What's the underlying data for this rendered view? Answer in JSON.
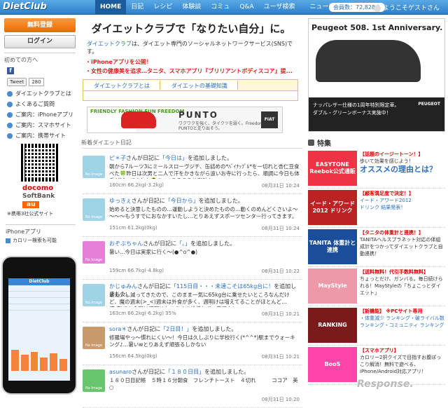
{
  "header": {
    "logo": "DietClub",
    "nav": [
      "HOME",
      "日記",
      "レシピ",
      "体験談",
      "コミュ",
      "Q&A",
      "ユーザ検索",
      "ニュース"
    ],
    "new_badge": "new",
    "members": "会員数：72,828人",
    "guest": "ようこそゲストさん"
  },
  "left": {
    "register": "無料登録",
    "login": "ログイン",
    "first_time": "初めての方へ",
    "tweet": "Tweet",
    "tweet_count": "280",
    "links": [
      "ダイエットクラブとは",
      "よくあるご質問",
      "ご案内：iPhoneアプリ",
      "ご案内：スマホサイト",
      "ご案内：携帯サイト"
    ],
    "docomo": "docomo",
    "softbank": "SoftBank",
    "au": "au",
    "mobile_note": "※携帯3社公式サイト",
    "iphone_app": "iPhoneアプリ",
    "calorie": "カロリー検索も可能"
  },
  "main": {
    "headline": "ダイエットクラブで「なりたい自分」に。",
    "intro_link": "ダイエットクラブ",
    "intro_rest": "は、ダイエット専門のソーシャルネットワークサービス(SNS)です。",
    "red1": "・iPhoneアプリを公開！",
    "red2": "・女性の健康美を追求…タニタ、スマホアプリ『ブリリアントボディスコア』提...",
    "tab1": "ダイエットクラブとは",
    "tab2": "ダイエットの基礎知識",
    "ad": {
      "left": "FRIENDLY FASHION FUN FREEDOM",
      "title": "PUNTO",
      "sub": "ワクワクを強く、タイクツを弱く。Freedom＝PUNTOと走り出そう。",
      "fiat": "FIAT"
    },
    "feed_head": "新着ダイエット日記",
    "entries": [
      {
        "user": "ピ＊子",
        "mid": "さんが日記に",
        "title": "「今日は」",
        "end": "を追加しました。",
        "body": "朝から7ルーツ3にミールスローヴジチ、缶詰めの*ﾊﾞｲﾅｯﾌﾟﾙ*を一切れと杏仁豆食べた🍀昨日は次男と二人で汗をかきながら遠いお寺に行ったら、順調に今日も体重が減ってました🙆あっ♪そろそろ体脂肪も…",
        "meta": "160cm 66.2kg(-3.2kg)",
        "date": "08月31日 10:24"
      },
      {
        "user": "ゆっきぇ",
        "mid": "さんが日記に",
        "title": "「今日から」",
        "end": "を追加しました。",
        "body": "始めると決意したものの…運動しようと決めたものの…動くのめんどくさいよ～～～～もうすでにおなかすいたし…とりあえずスポーツセンター行ってきます。",
        "meta": "151cm 61.2kg(0kg)",
        "date": "08月31日 10:24"
      },
      {
        "user": "おぞぶちゃん",
        "mid": "さんが日記に",
        "title": "「。」",
        "end": "を追加しました。",
        "body": "暑い…今日は実家に行く～(●^o^●)",
        "meta": "159cm 66.7kg(-4.8kg)",
        "date": "08月31日 10:22"
      },
      {
        "user": "かじゅみん",
        "mid": "さんが日記に",
        "title": "「115日目・・・未達こそは65kg台に！",
        "end": "を追加しました。",
        "body": "最近少し減ってきたので、このまま一気に65kg台に乗せたいところなんだけど、魔の週末(>_<)週末は外食が多く、週明けは増えてることがほとんど…(T_T)でも今回は週明けもこのまま維持して、来週中に…",
        "meta": "163cm 66.2kg(-6.2kg) 35%",
        "date": "08月31日 10:21"
      },
      {
        "user": "sora＊",
        "mid": "さんが日記に",
        "title": "「2日目！」",
        "end": "を追加しました。",
        "body": "修羅場やっ～慣れにくい～！今日は久しぶりに学校行く(*^^*)駅までウォーキング♪…暑いwとりあえず頑張るしかない",
        "meta": "156cm 64.5kg(0kg)",
        "date": "08月31日 10:21"
      },
      {
        "user": "asunaro",
        "mid": "さんが日記に",
        "title": "「１８０日目」",
        "end": "を追加しました。",
        "body": "１８０日目記帳　５時１６分朝食　フレンチトースト　４切れ　　　ココア　美　○",
        "meta": "",
        "date": "08月31日 10:20"
      }
    ]
  },
  "right": {
    "peugeot_title": "Peugeot 508. 1st Anniversary.",
    "peugeot_copy1": "ナッパレザー仕様の1周年特別限定車。",
    "peugeot_copy2": "ダブル・グリーンボーナス実施中！",
    "peugeot_logo": "PEUGEOT",
    "tokushu": "特集",
    "features": [
      {
        "logo": "EASYTONE Reebok公式通販",
        "h": "【話題のイージートーン！】",
        "l1": "歩いて効果を感じよう！",
        "big": "オススメの理由とは？",
        "c": "#e34"
      },
      {
        "logo": "イード・アワード2012 ドリンク",
        "h": "【顧客満足度で決定！】",
        "l1": "イード・アワード2012",
        "big": "ドリンク 結果発表！",
        "c": "#b22"
      },
      {
        "logo": "TANITA 体重計と連携",
        "h": "【タニタの体重計と連携！】",
        "l1": "TANITAヘルスプラネット対応の体組成計をつかってダイエットクラブと自動連携！",
        "big": "",
        "c": "#1a4e9a"
      },
      {
        "logo": "MayStyle",
        "h": "【送料無料！代引手数料無料】",
        "l1": "ちょっとだけ、ガンバる。毎日続けられる！MayStyleの「ちょこっとダイエット」",
        "big": "",
        "c": "#e9a"
      },
      {
        "logo": "RANKING",
        "h": "【新機能】 ※PCサイト専用",
        "l1": "・体重減少 ランキング・破ライバル数 ランキング・コミュニティ ランキング",
        "big": "",
        "c": "#7a1a1a"
      },
      {
        "logo": "BooS",
        "h": "【スマホアプリ】",
        "l1": "カロリー2択クイズで目指すお腹ぽっこり解消！無料で遊べる、iPhone/Android対応アプリ！",
        "big": "",
        "c": "#f4a"
      }
    ],
    "watermark": "Response."
  }
}
